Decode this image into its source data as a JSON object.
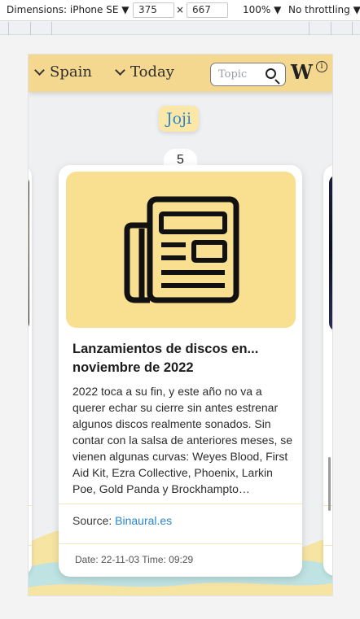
{
  "devtools": {
    "dimensions_label": "Dimensions: iPhone SE ▼",
    "width": "375",
    "times": "×",
    "height": "667",
    "zoom": "100% ▼",
    "throttling": "No throttling ▼"
  },
  "header": {
    "country": "Spain",
    "date_range": "Today",
    "search_placeholder": "Topic",
    "logo": "W",
    "info": "i"
  },
  "topic": "Joji",
  "card_counter": "5",
  "card": {
    "title": "Lanzamientos de discos en... noviembre de 2022",
    "description": "2022 toca a su fin, y este año no va a querer echar su cierre sin antes estrenar algunos discos realmente sonados. Sin contar con la salsa de anteriores meses, se vienen algunas curvas: Weyes Blood, First Aid Kit, Ezra Collective, Phoenix, Larkin Poe, Gold Panda y Brockhampto…",
    "source_label": "Source:",
    "source_name": "Binaural.es",
    "meta": "Date: 22-11-03 Time: 09:29",
    "icon": "newspaper-icon"
  },
  "colors": {
    "header_bg": "#f5d88f",
    "thumb_bg": "#f9df90",
    "topic_bg": "#fbe7a8",
    "link": "#2a86c8",
    "wave_yellow": "#f6e4a3",
    "wave_blue": "#bfe3e3"
  }
}
